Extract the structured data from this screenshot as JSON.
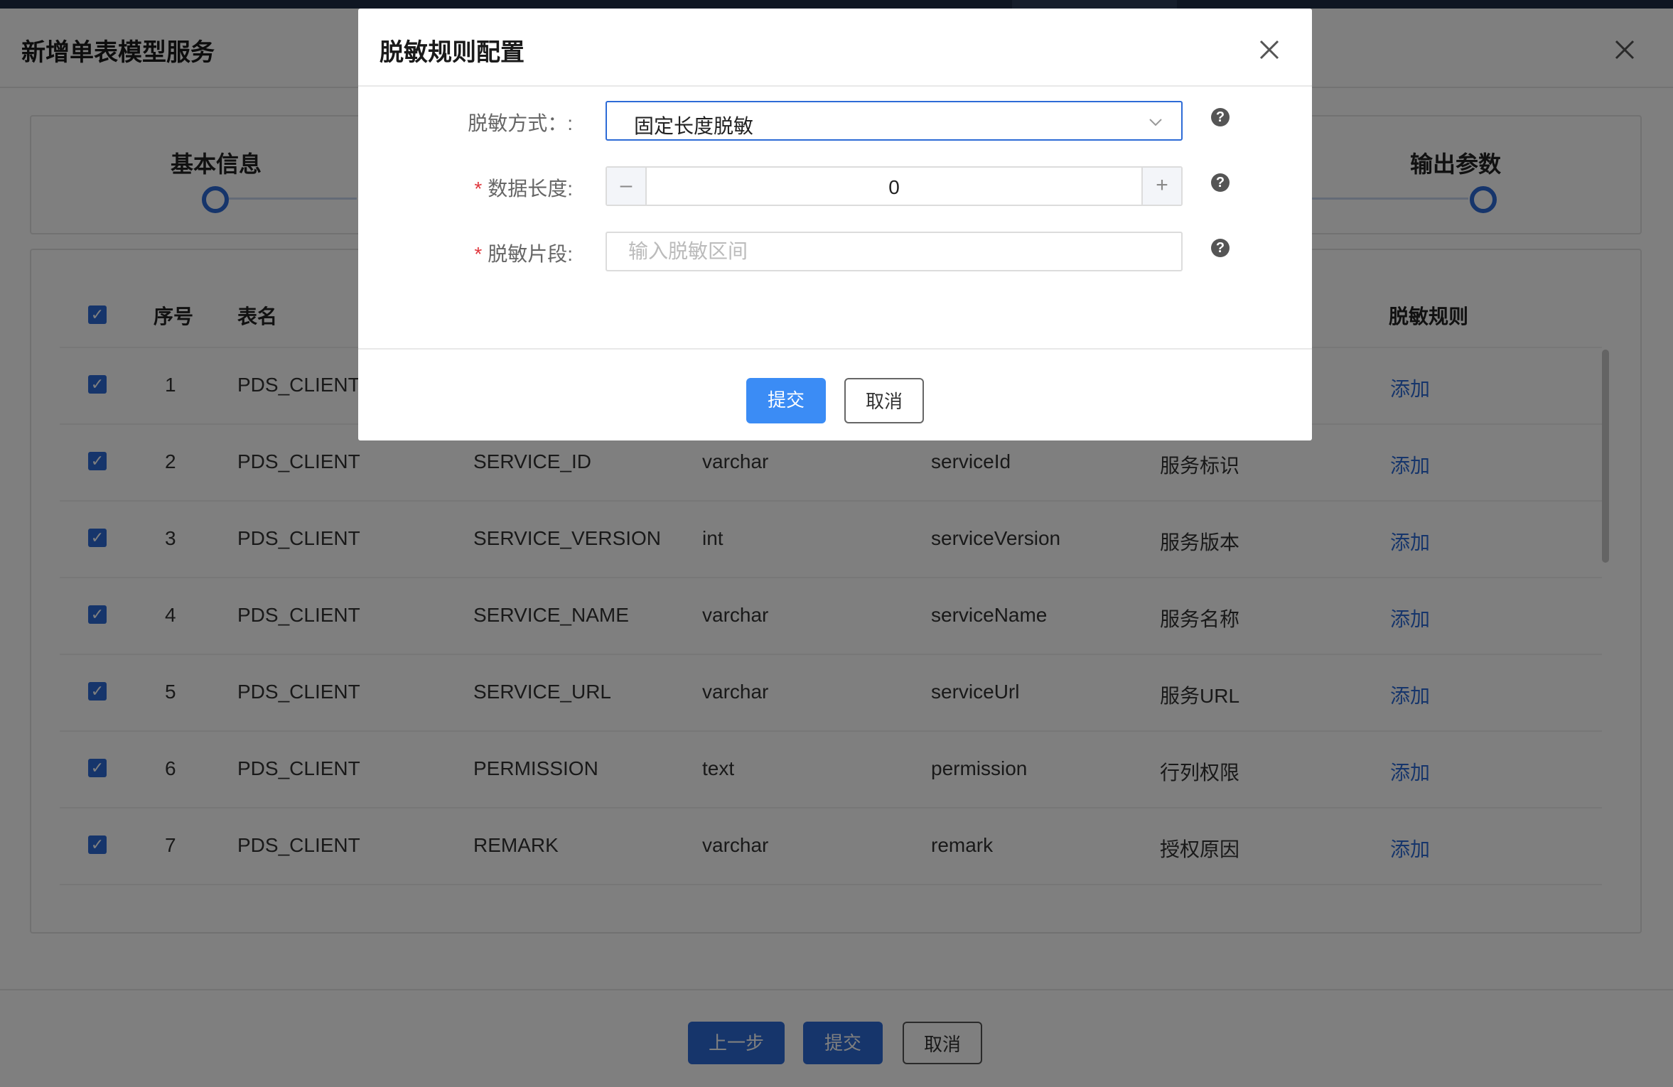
{
  "base": {
    "title": "新增单表模型服务",
    "steps": [
      "基本信息",
      "输出参数"
    ],
    "table": {
      "headers": [
        "序号",
        "表名",
        "脱敏规则"
      ],
      "rows": [
        {
          "index": "1",
          "table": "PDS_CLIENT",
          "column": "",
          "type": "",
          "field": "",
          "desc": "",
          "action": "添加"
        },
        {
          "index": "2",
          "table": "PDS_CLIENT",
          "column": "SERVICE_ID",
          "type": "varchar",
          "field": "serviceId",
          "desc": "服务标识",
          "action": "添加"
        },
        {
          "index": "3",
          "table": "PDS_CLIENT",
          "column": "SERVICE_VERSION",
          "type": "int",
          "field": "serviceVersion",
          "desc": "服务版本",
          "action": "添加"
        },
        {
          "index": "4",
          "table": "PDS_CLIENT",
          "column": "SERVICE_NAME",
          "type": "varchar",
          "field": "serviceName",
          "desc": "服务名称",
          "action": "添加"
        },
        {
          "index": "5",
          "table": "PDS_CLIENT",
          "column": "SERVICE_URL",
          "type": "varchar",
          "field": "serviceUrl",
          "desc": "服务URL",
          "action": "添加"
        },
        {
          "index": "6",
          "table": "PDS_CLIENT",
          "column": "PERMISSION",
          "type": "text",
          "field": "permission",
          "desc": "行列权限",
          "action": "添加"
        },
        {
          "index": "7",
          "table": "PDS_CLIENT",
          "column": "REMARK",
          "type": "varchar",
          "field": "remark",
          "desc": "授权原因",
          "action": "添加"
        }
      ]
    },
    "footer": {
      "prev": "上一步",
      "submit": "提交",
      "cancel": "取消"
    }
  },
  "modal": {
    "title": "脱敏规则配置",
    "method_label": "脱敏方式：:",
    "method_value": "固定长度脱敏",
    "length_label": "数据长度:",
    "length_value": "0",
    "segment_label": "脱敏片段:",
    "segment_placeholder": "输入脱敏区间",
    "submit": "提交",
    "cancel": "取消"
  },
  "colors": {
    "primary": "#2d6bd6",
    "primary_light": "#3b8cf5",
    "required": "#e0383e"
  }
}
